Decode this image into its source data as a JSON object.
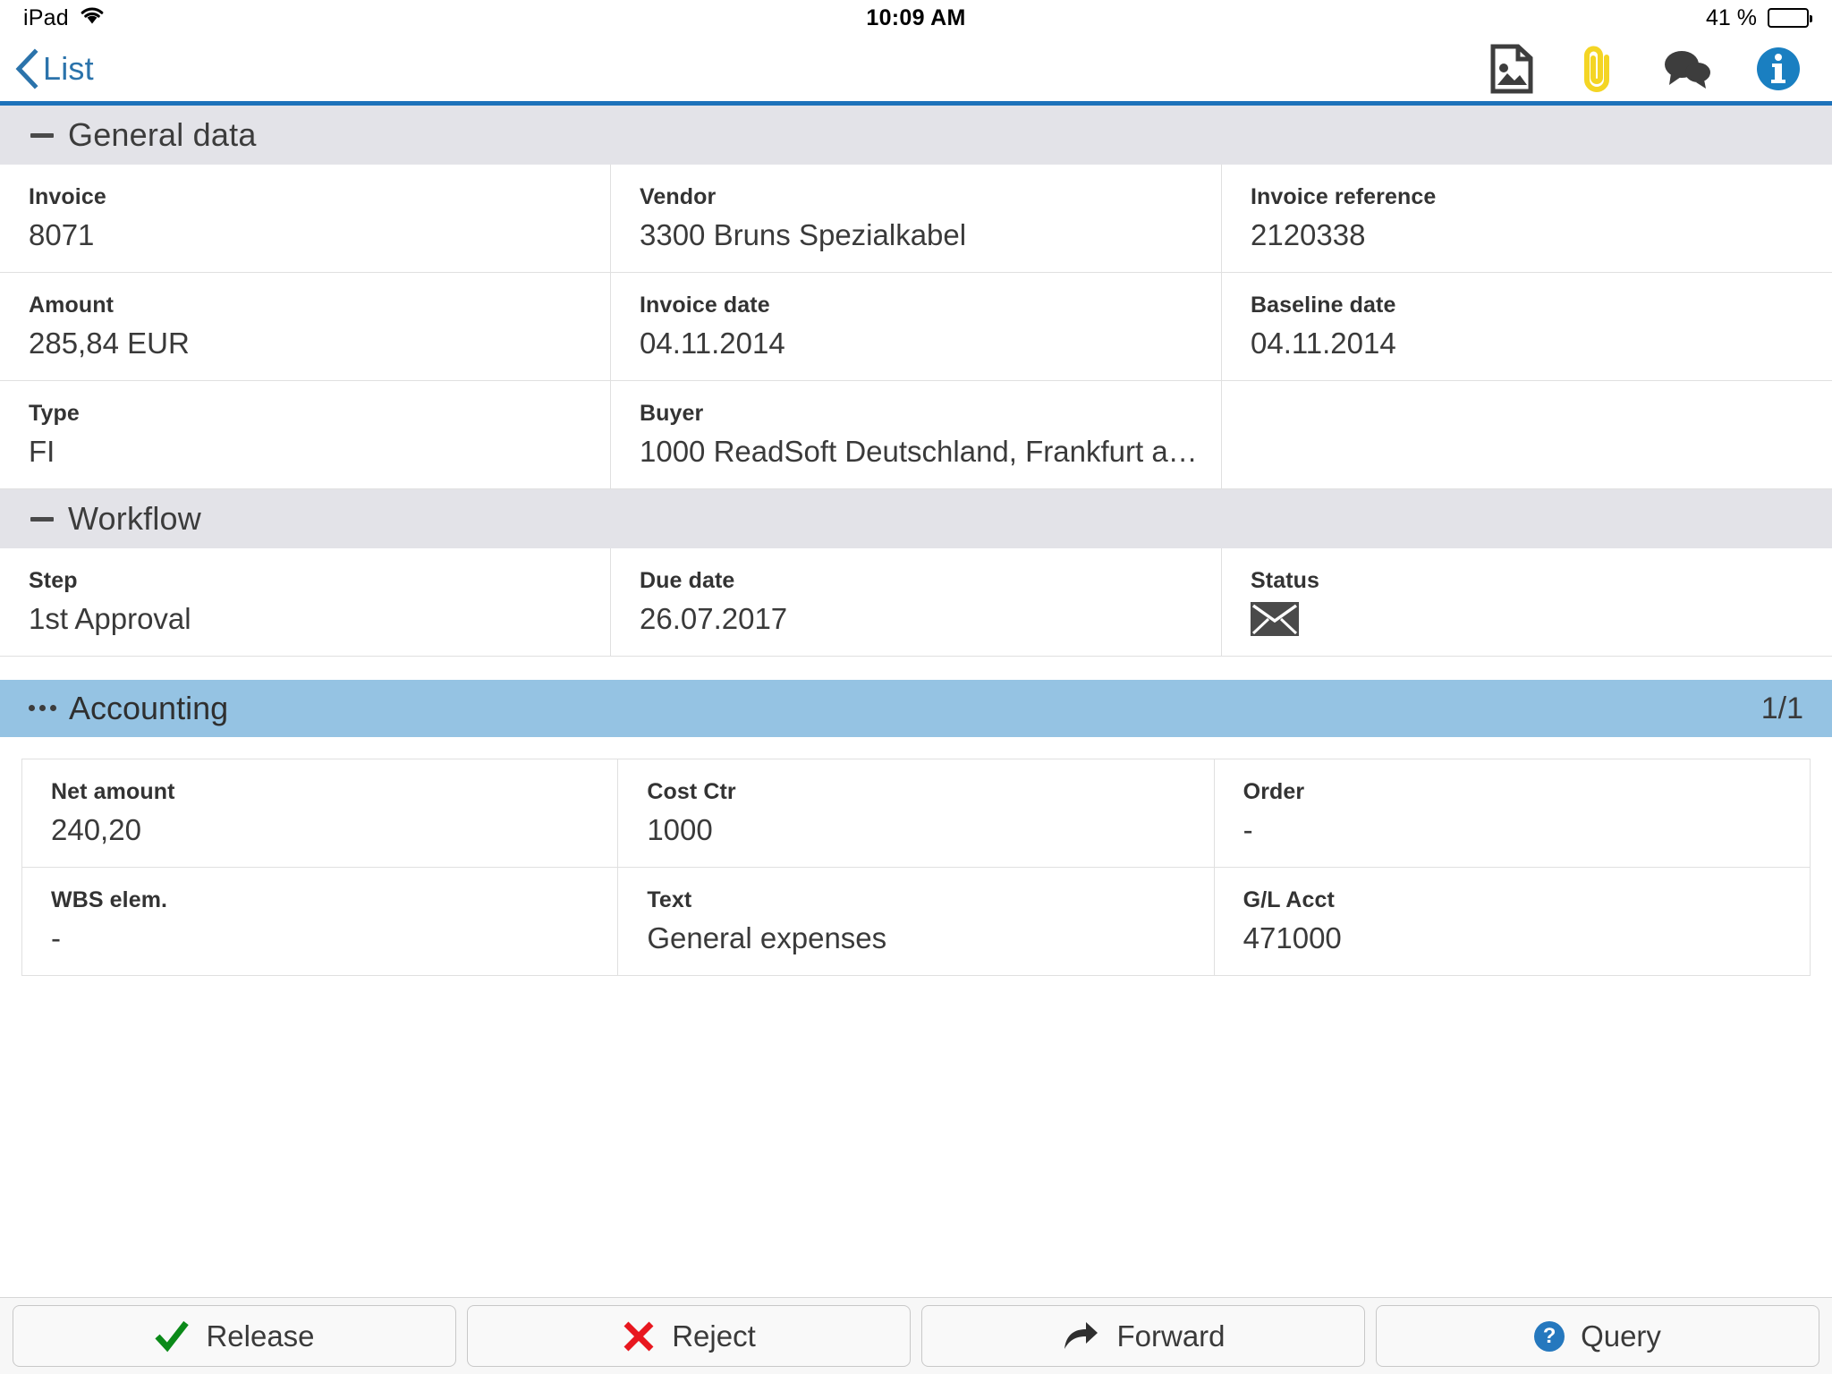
{
  "status_bar": {
    "device": "iPad",
    "wifi_icon": "wifi-icon",
    "time": "10:09 AM",
    "battery_percent": "41 %",
    "battery_level": 50
  },
  "nav_bar": {
    "back_label": "List",
    "back_icon": "chevron-left-icon",
    "accent_color": "#2b73ab",
    "separator_color": "#1d72ba",
    "actions": [
      {
        "name": "document-image-icon",
        "label": "Image",
        "color": "#3d3d3d"
      },
      {
        "name": "paperclip-icon",
        "label": "Attachments",
        "color": "#f4d524"
      },
      {
        "name": "comments-icon",
        "label": "Comments",
        "color": "#3d3d3d"
      },
      {
        "name": "info-icon",
        "label": "Info",
        "color": "#1a7fc1"
      }
    ]
  },
  "sections": {
    "general": {
      "title": "General data",
      "toggle_icon": "minus-icon",
      "rows": [
        [
          {
            "label": "Invoice",
            "value": "8071"
          },
          {
            "label": "Vendor",
            "value": "3300 Bruns Spezialkabel"
          },
          {
            "label": "Invoice reference",
            "value": "2120338"
          }
        ],
        [
          {
            "label": "Amount",
            "value": "285,84 EUR"
          },
          {
            "label": "Invoice date",
            "value": "04.11.2014"
          },
          {
            "label": "Baseline date",
            "value": "04.11.2014"
          }
        ],
        [
          {
            "label": "Type",
            "value": "FI"
          },
          {
            "label": "Buyer",
            "value": "1000 ReadSoft Deutschland, Frankfurt a…"
          },
          {
            "label": "",
            "value": ""
          }
        ]
      ]
    },
    "workflow": {
      "title": "Workflow",
      "toggle_icon": "minus-icon",
      "rows": [
        [
          {
            "label": "Step",
            "value": "1st Approval"
          },
          {
            "label": "Due date",
            "value": "26.07.2017"
          },
          {
            "label": "Status",
            "value": "",
            "icon": "envelope-icon"
          }
        ]
      ]
    },
    "accounting": {
      "title": "Accounting",
      "toggle_icon": "dots-icon",
      "counter": "1/1",
      "header_color": "#95c3e3",
      "rows": [
        [
          {
            "label": "Net amount",
            "value": "240,20"
          },
          {
            "label": "Cost Ctr",
            "value": "1000"
          },
          {
            "label": "Order",
            "value": "-"
          }
        ],
        [
          {
            "label": "WBS elem.",
            "value": "-"
          },
          {
            "label": "Text",
            "value": "General expenses"
          },
          {
            "label": "G/L Acct",
            "value": "471000"
          }
        ]
      ]
    }
  },
  "toolbar": {
    "buttons": [
      {
        "label": "Release",
        "icon": "check-icon",
        "color": "#0b8a19"
      },
      {
        "label": "Reject",
        "icon": "cross-icon",
        "color": "#e8171f"
      },
      {
        "label": "Forward",
        "icon": "forward-arrow-icon",
        "color": "#2f2f2f"
      },
      {
        "label": "Query",
        "icon": "question-circle-icon",
        "color": "#2578be"
      }
    ]
  }
}
